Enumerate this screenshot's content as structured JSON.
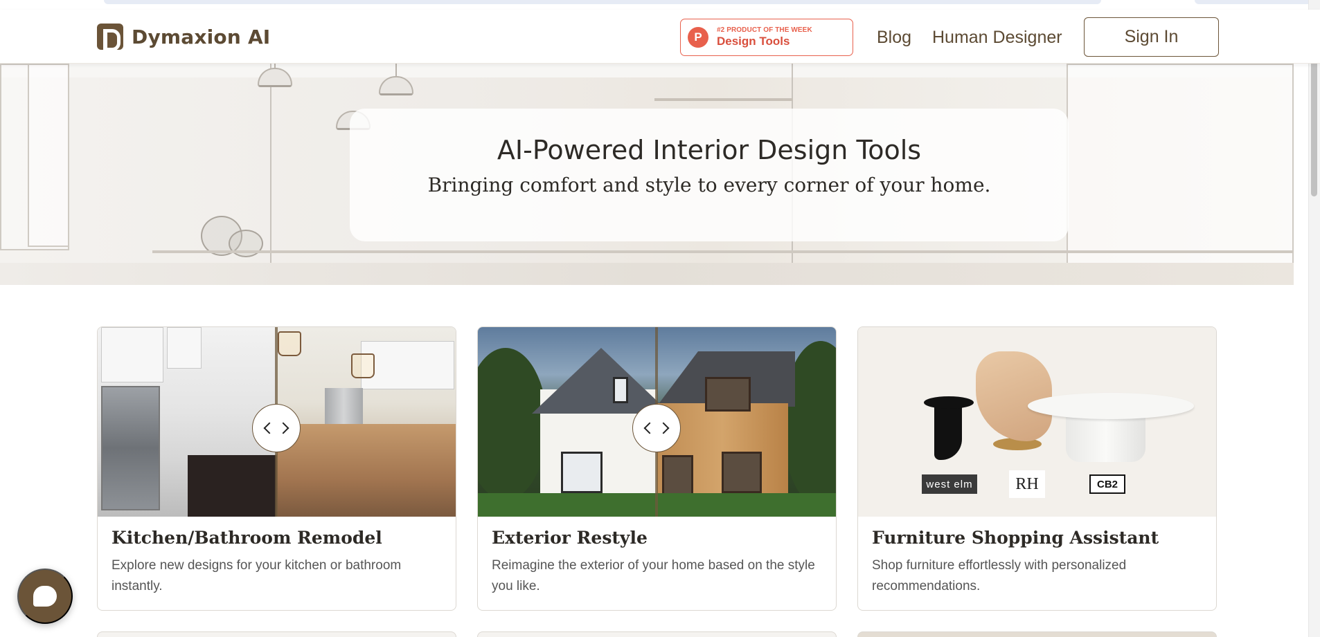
{
  "brand": {
    "name": "Dymaxion AI",
    "accent_color": "#6b5438"
  },
  "header": {
    "product_hunt": {
      "badge_letter": "P",
      "rank_text": "#2 PRODUCT OF THE WEEK",
      "category": "Design Tools",
      "color": "#e8604c"
    },
    "nav": {
      "blog": "Blog",
      "human_designer": "Human Designer",
      "sign_in": "Sign In"
    }
  },
  "hero": {
    "title": "AI-Powered Interior Design Tools",
    "subtitle": "Bringing comfort and style to every corner of your home."
  },
  "cards": [
    {
      "title": "Kitchen/Bathroom Remodel",
      "description": "Explore new designs for your kitchen or bathroom instantly.",
      "image_icon": "kitchen-before-after-slider"
    },
    {
      "title": "Exterior Restyle",
      "description": "Reimagine the exterior of your home based on the style you like.",
      "image_icon": "house-exterior-before-after-slider"
    },
    {
      "title": "Furniture Shopping Assistant",
      "description": "Shop furniture effortlessly with personalized recommendations.",
      "brands": [
        "west elm",
        "RH",
        "CB2"
      ]
    }
  ],
  "chat": {
    "icon": "chat-bubble-icon"
  }
}
